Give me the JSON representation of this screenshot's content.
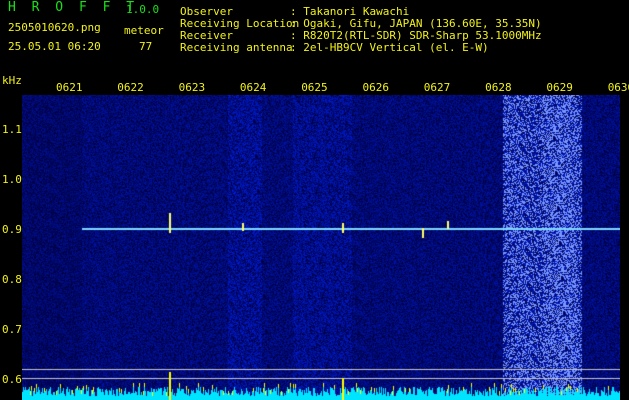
{
  "app": {
    "name": "H R O F F T",
    "version": "1.0.0"
  },
  "file": {
    "name": "2505010620.png",
    "datetime": "25.05.01 06:20"
  },
  "meteor": {
    "label": "meteor",
    "count": "77"
  },
  "station": {
    "observer_label": "Observer",
    "observer": ": Takanori Kawachi",
    "location_label": "Receiving Location",
    "location": ": Ogaki, Gifu, JAPAN (136.60E, 35.35N)",
    "receiver_label": "Receiver",
    "receiver": ": R820T2(RTL-SDR) SDR-Sharp 53.1000MHz",
    "antenna_label": "Receiving antenna",
    "antenna": ": 2el-HB9CV Vertical (el. E-W)"
  },
  "x_axis": {
    "ticks": [
      "0621",
      "0622",
      "0623",
      "0624",
      "0625",
      "0626",
      "0627",
      "0628",
      "0629",
      "0630"
    ]
  },
  "y_axis": {
    "unit": "kHz",
    "ticks": [
      "1.1",
      "1.0",
      "0.9",
      "0.8",
      "0.7",
      "0.6"
    ]
  },
  "colors": {
    "text": "#f2f21a",
    "title": "#19e019",
    "noise": "#001a8c",
    "trace": "#7fd8ff",
    "bars": "#00e5ff"
  }
}
